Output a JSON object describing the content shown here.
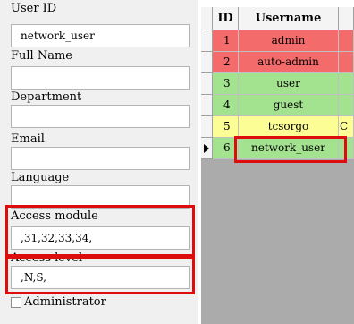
{
  "form": {
    "user_id_label": "User ID",
    "user_id_value": "network_user",
    "full_name_label": "Full Name",
    "full_name_value": "",
    "department_label": "Department",
    "department_value": "",
    "email_label": "Email",
    "email_value": "",
    "language_label": "Language",
    "language_value": "",
    "access_module_label": "Access module",
    "access_module_value": ",31,32,33,34,",
    "access_level_label": "Access level",
    "access_level_value": ",N,S,",
    "administrator_label": "Administrator",
    "administrator_checked": false
  },
  "grid": {
    "headers": {
      "id": "ID",
      "username": "Username",
      "extra": ""
    },
    "rows": [
      {
        "id": "1",
        "username": "admin",
        "extra": "",
        "color": "#f36b6b"
      },
      {
        "id": "2",
        "username": "auto-admin",
        "extra": "",
        "color": "#f36b6b"
      },
      {
        "id": "3",
        "username": "user",
        "extra": "",
        "color": "#a3e28f"
      },
      {
        "id": "4",
        "username": "guest",
        "extra": "",
        "color": "#a3e28f"
      },
      {
        "id": "5",
        "username": "tcsorgo",
        "extra": "C",
        "color": "#fdfd96"
      },
      {
        "id": "6",
        "username": "network_user",
        "extra": "",
        "color": "#a3e28f",
        "selected": true
      }
    ]
  },
  "colors": {
    "highlight": "#dd0d0d"
  }
}
